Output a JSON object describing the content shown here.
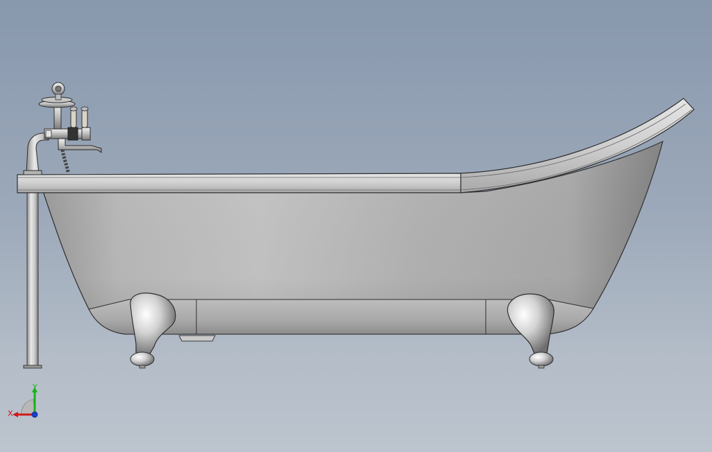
{
  "triad": {
    "y_label": "Y",
    "x_label": "X",
    "y_color": "#19b319",
    "x_color": "#d11a1a",
    "z_color": "#1a3fd1"
  },
  "scene": {
    "background_top": "#8898ad",
    "background_bottom": "#bcc4ce",
    "object": "clawfoot-bathtub-with-faucet",
    "view": "front"
  }
}
